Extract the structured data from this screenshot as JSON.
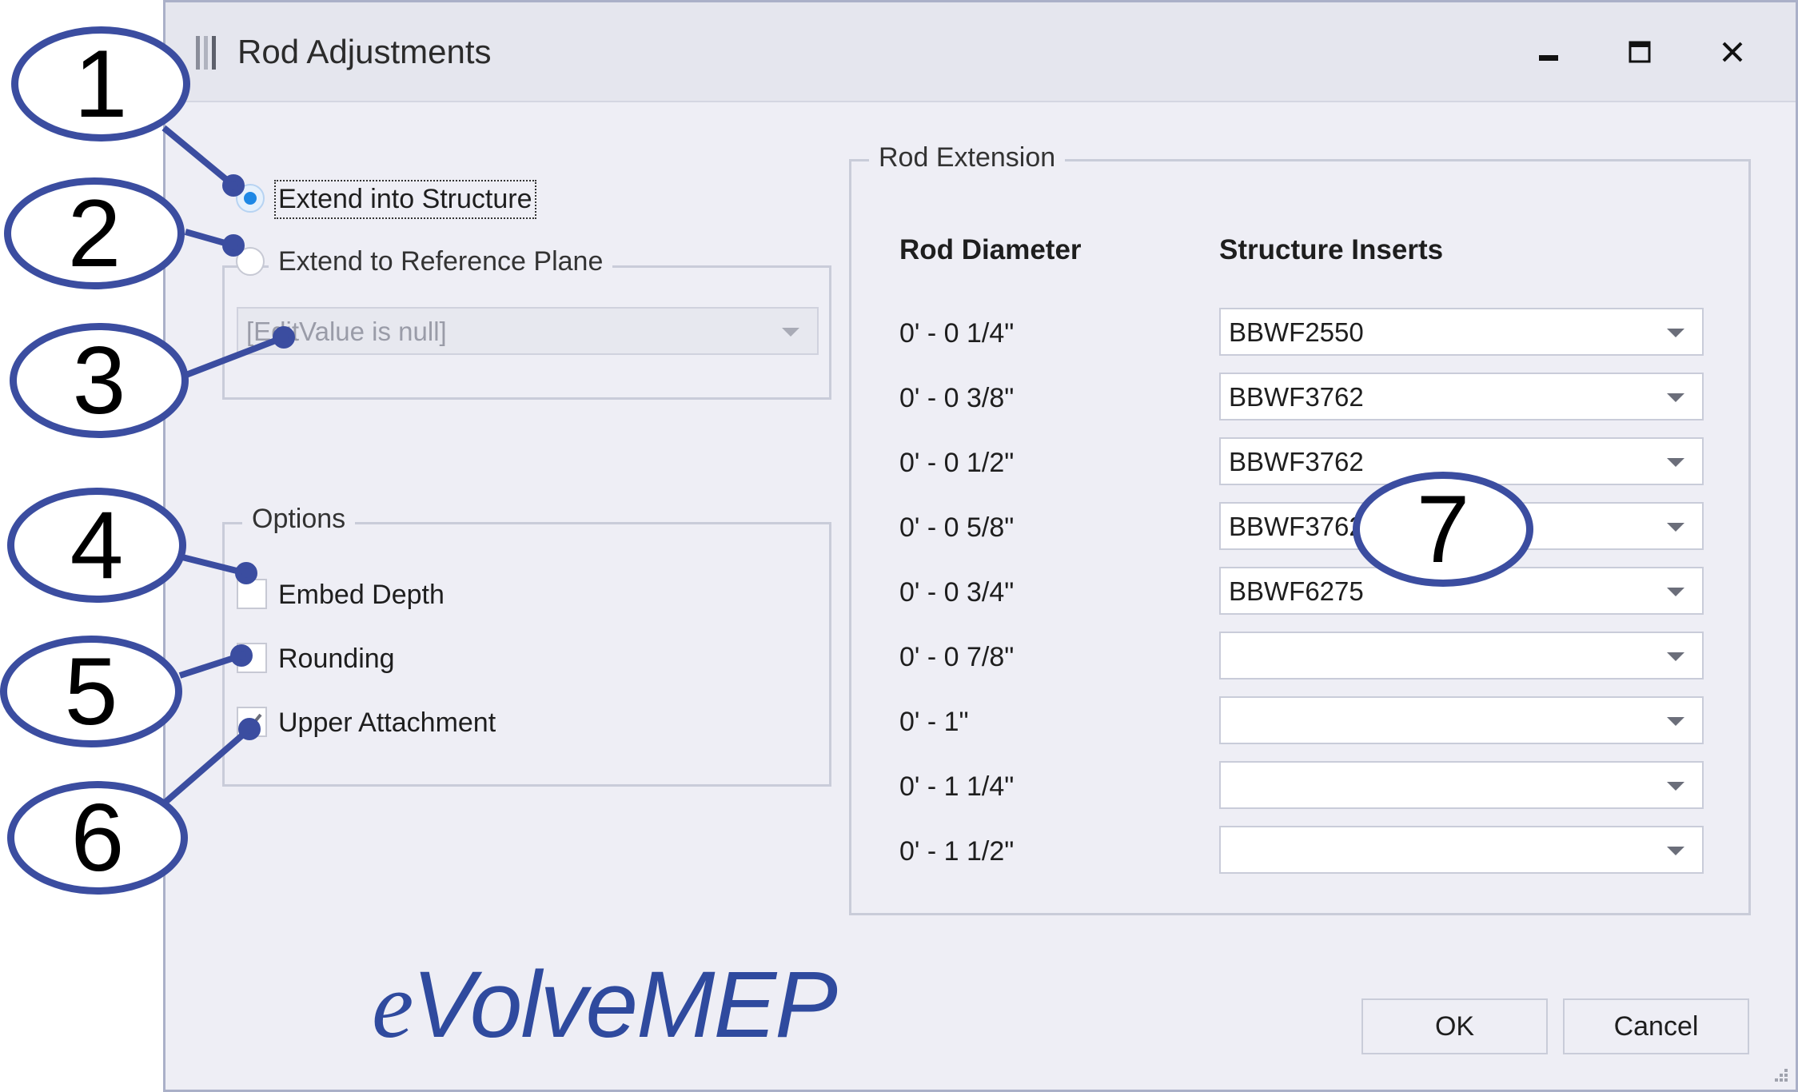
{
  "window": {
    "title": "Rod Adjustments",
    "icons": [
      "app-rod-icon",
      "minimize-icon",
      "maximize-icon",
      "close-icon"
    ]
  },
  "mode": {
    "extend_into_structure": {
      "label": "Extend into Structure",
      "selected": true
    },
    "extend_to_reference_plane": {
      "label": "Extend to Reference Plane",
      "selected": false
    },
    "reference_plane_combo": {
      "value": "[EditValue is null]",
      "enabled": false
    }
  },
  "options": {
    "title": "Options",
    "embed_depth": {
      "label": "Embed Depth",
      "checked": false
    },
    "rounding": {
      "label": "Rounding",
      "checked": false
    },
    "upper_attachment": {
      "label": "Upper Attachment",
      "checked": true
    }
  },
  "rod_extension": {
    "title": "Rod Extension",
    "col_diameter": "Rod Diameter",
    "col_inserts": "Structure Inserts",
    "rows": [
      {
        "diameter": "0' - 0 1/4\"",
        "insert": "BBWF2550"
      },
      {
        "diameter": "0' - 0 3/8\"",
        "insert": "BBWF3762"
      },
      {
        "diameter": "0' - 0 1/2\"",
        "insert": "BBWF3762"
      },
      {
        "diameter": "0' - 0 5/8\"",
        "insert": "BBWF3762"
      },
      {
        "diameter": "0' - 0 3/4\"",
        "insert": "BBWF6275"
      },
      {
        "diameter": "0' - 0 7/8\"",
        "insert": ""
      },
      {
        "diameter": "0' - 1\"",
        "insert": ""
      },
      {
        "diameter": "0' - 1 1/4\"",
        "insert": ""
      },
      {
        "diameter": "0' - 1 1/2\"",
        "insert": ""
      }
    ]
  },
  "buttons": {
    "ok": "OK",
    "cancel": "Cancel"
  },
  "logo": {
    "prefix": "e",
    "rest": "VolveMEP"
  },
  "callouts": [
    "1",
    "2",
    "3",
    "4",
    "5",
    "6",
    "7"
  ],
  "colors": {
    "accent": "#1e88e5",
    "callout_border": "#3b4da0",
    "logo": "#2f4a9e",
    "dialog_bg": "#eeeef5"
  }
}
